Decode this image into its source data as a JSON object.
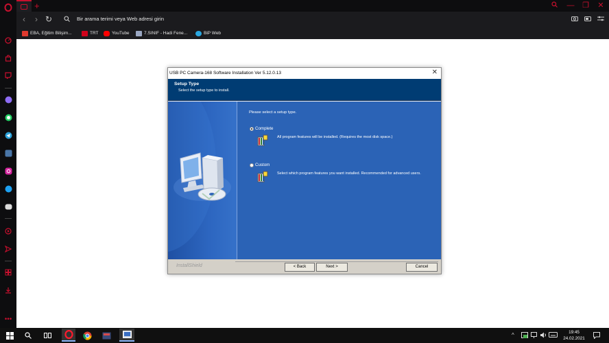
{
  "browser": {
    "address_placeholder": "Bir arama terimi veya Web adresi girin",
    "bookmarks": [
      {
        "label": "EBA, Eğitim Bilişim...",
        "color": "#e03a2f"
      },
      {
        "label": "TRT",
        "color": "#d0021b"
      },
      {
        "label": "YouTube",
        "color": "#ff0000"
      },
      {
        "label": "7.SINIF - Hadi Fene...",
        "color": "#9aa7c2"
      },
      {
        "label": "BiP Web",
        "color": "#2aa7e0"
      }
    ],
    "accent": "#c8102e"
  },
  "dialog": {
    "title": "USB PC Camera-168 Software Installation Ver 5.12.0.13",
    "header_title": "Setup Type",
    "header_subtitle": "Select the setup type to install.",
    "prompt": "Please select a setup type.",
    "options": [
      {
        "label": "Complete",
        "selected": true,
        "description": "All program features will be installed. (Requires the most disk space.)"
      },
      {
        "label": "Custom",
        "selected": false,
        "description": "Select which program features you want installed. Recommended for advanced users."
      }
    ],
    "brand": "InstallShield",
    "buttons": {
      "back": "< Back",
      "next": "Next >",
      "cancel": "Cancel"
    }
  },
  "taskbar": {
    "time": "19:45",
    "date": "24.02.2021"
  }
}
